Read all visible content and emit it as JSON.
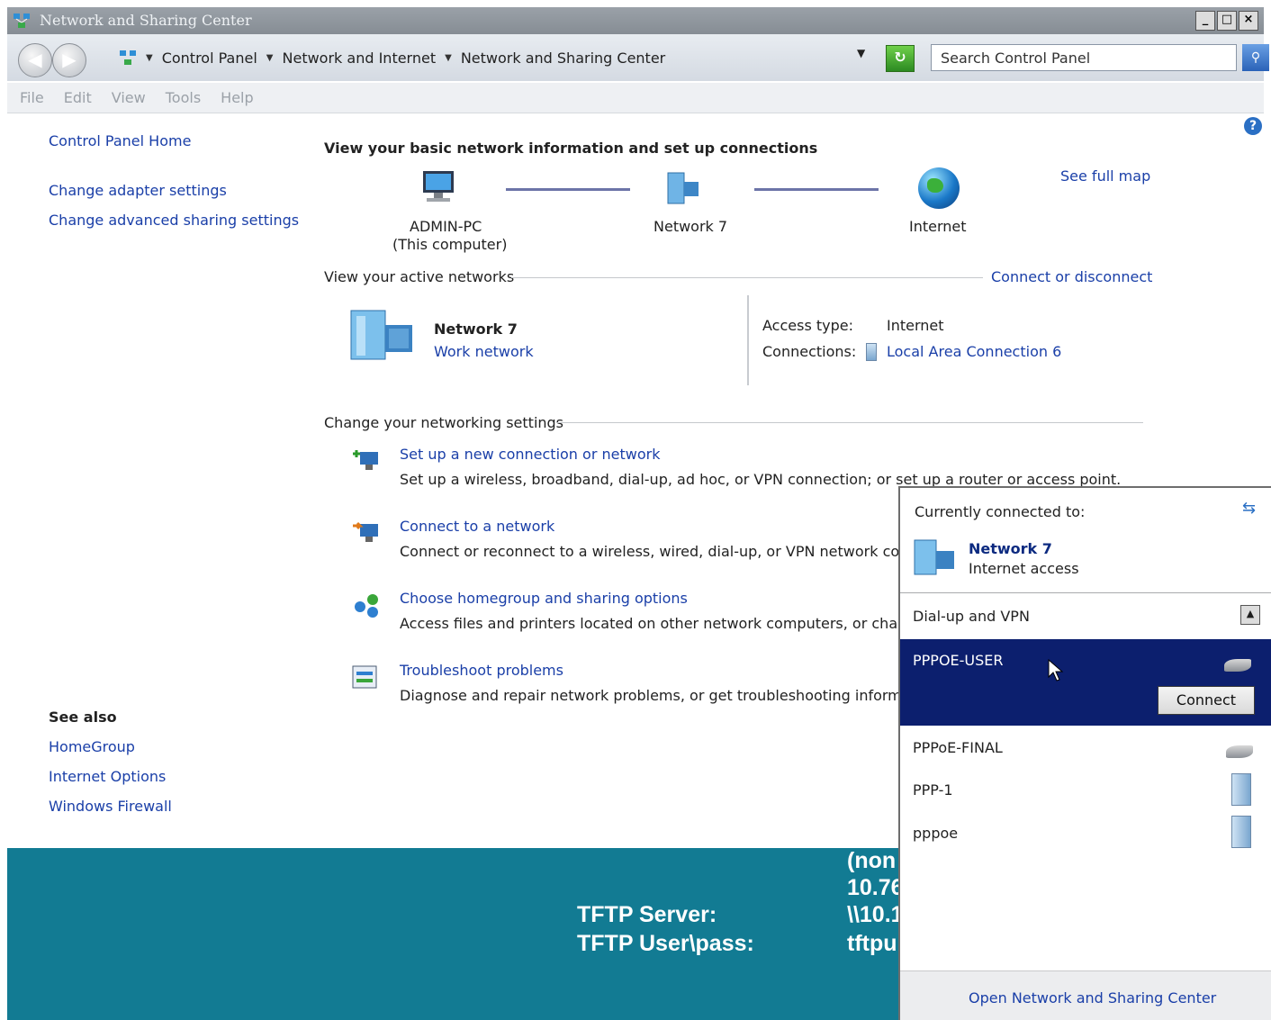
{
  "window": {
    "title": "Network and Sharing Center"
  },
  "address": {
    "crumbs": [
      "Control Panel",
      "Network and Internet",
      "Network and Sharing Center"
    ],
    "search_placeholder": "Search Control Panel"
  },
  "menu": [
    "File",
    "Edit",
    "View",
    "Tools",
    "Help"
  ],
  "left": {
    "home": "Control Panel Home",
    "links": [
      "Change adapter settings",
      "Change advanced sharing settings"
    ],
    "see_also_title": "See also",
    "see_also": [
      "HomeGroup",
      "Internet Options",
      "Windows Firewall"
    ]
  },
  "main": {
    "heading": "View your basic network information and set up connections",
    "see_full_map": "See full map",
    "map": {
      "computer": "ADMIN-PC",
      "computer_sub": "(This computer)",
      "network": "Network  7",
      "internet": "Internet"
    },
    "active_title": "View your active networks",
    "connect_disconnect": "Connect or disconnect",
    "active": {
      "name": "Network  7",
      "type": "Work network",
      "access_label": "Access type:",
      "access_value": "Internet",
      "conn_label": "Connections:",
      "conn_value": "Local Area Connection 6"
    },
    "change_title": "Change your networking settings",
    "tasks": [
      {
        "title": "Set up a new connection or network",
        "desc": "Set up a wireless, broadband, dial-up, ad hoc, or VPN connection; or set up a router or access point."
      },
      {
        "title": "Connect to a network",
        "desc": "Connect or reconnect to a wireless, wired, dial-up, or VPN network conne"
      },
      {
        "title": "Choose homegroup and sharing options",
        "desc": "Access files and printers located on other network computers, or change s"
      },
      {
        "title": "Troubleshoot problems",
        "desc": "Diagnose and repair network problems, or get troubleshooting informatio"
      }
    ]
  },
  "teal": {
    "col1": [
      "TFTP Server:",
      "TFTP User\\pass:"
    ],
    "col2": [
      "(non",
      "10.76",
      "\\\\10.1",
      "tftpu"
    ]
  },
  "popup": {
    "currently": "Currently connected to:",
    "net_name": "Network  7",
    "net_status": "Internet access",
    "section": "Dial-up and VPN",
    "selected": "PPPOE-USER",
    "connect_btn": "Connect",
    "items": [
      "PPPoE-FINAL",
      "PPP-1",
      "pppoe"
    ],
    "footer": "Open Network and Sharing Center"
  },
  "colors": {
    "link": "#1a3fa8",
    "selection": "#0c1f6e",
    "teal": "#127b93"
  }
}
